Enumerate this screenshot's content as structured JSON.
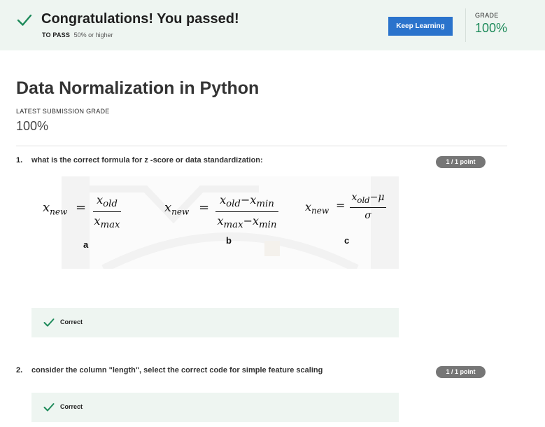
{
  "banner": {
    "headline": "Congratulations! You passed!",
    "to_pass_label": "TO PASS",
    "to_pass_value": "50% or higher",
    "keep_learning": "Keep Learning",
    "grade_label": "GRADE",
    "grade_value": "100%"
  },
  "page": {
    "title": "Data Normalization in Python",
    "latest_label": "LATEST SUBMISSION GRADE",
    "latest_value": "100%"
  },
  "questions": [
    {
      "number": "1.",
      "text": "what is the correct formula for z -score or data standardization:",
      "points": "1 / 1 point",
      "feedback": "Correct",
      "formulas": [
        {
          "label": "a",
          "lhs": "x",
          "lhs_sub": "new",
          "num": "x",
          "num_sub": "old",
          "den": "x",
          "den_sub": "max"
        },
        {
          "label": "b",
          "lhs": "x",
          "lhs_sub": "new",
          "num": "x",
          "num_sub": "old",
          "num_tail": "−x",
          "num_tail_sub": "min",
          "den": "x",
          "den_sub": "max",
          "den_tail": "−x",
          "den_tail_sub": "min"
        },
        {
          "label": "c",
          "lhs": "x",
          "lhs_sub": "new",
          "num": "x",
          "num_sub": "old",
          "num_tail": "−μ",
          "den": "σ"
        }
      ]
    },
    {
      "number": "2.",
      "text": "consider the column \"length\", select the correct code for simple feature scaling",
      "points": "1 / 1 point",
      "feedback": "Correct"
    }
  ],
  "colors": {
    "accent_green": "#1d8a5a",
    "button_blue": "#2a73cc",
    "banner_bg": "#eef5f1",
    "badge_gray": "#767676"
  }
}
